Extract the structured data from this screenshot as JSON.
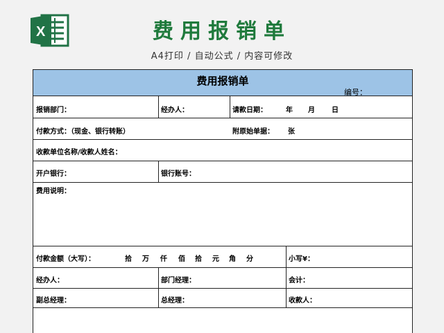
{
  "banner": {
    "title": "费用报销单",
    "subtitle": "A4打印 / 自动公式 / 内容可修改",
    "logo_icon": "excel-icon"
  },
  "form": {
    "title": "费用报销单",
    "serial_label": "编号：",
    "rows": {
      "dept_label": "报销部门：",
      "handler_label": "经办人：",
      "date_label": "请款日期：",
      "date_year": "年",
      "date_month": "月",
      "date_day": "日",
      "pay_method_label": "付款方式：（现金、银行转账）",
      "attachments_label": "附原始单据：",
      "attachments_unit": "张",
      "payee_label": "收款单位名称/收款人姓名：",
      "bank_label": "开户银行：",
      "account_label": "银行账号：",
      "desc_label": "费用说明：",
      "amount_label": "付款金额（大写）：",
      "amount_units": [
        "拾",
        "万",
        "仟",
        "佰",
        "拾",
        "元",
        "角",
        "分"
      ],
      "subtotal_label": "小写¥：",
      "handler2_label": "经办人：",
      "dept_manager_label": "部门经理：",
      "accountant_label": "会计：",
      "vice_gm_label": "副总经理：",
      "gm_label": "总经理：",
      "receiver_label": "收款人："
    }
  },
  "colors": {
    "header_fill": "#9dc3e6",
    "banner_green": "#1f7a3c",
    "excel_green": "#217346"
  }
}
